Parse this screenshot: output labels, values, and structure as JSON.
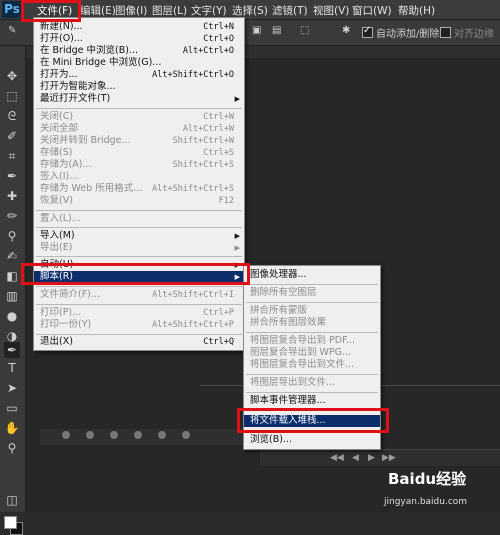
{
  "menubar": {
    "items": [
      "文件(F)",
      "编辑(E)",
      "图像(I)",
      "图层(L)",
      "文字(Y)",
      "选择(S)",
      "滤镜(T)",
      "视图(V)",
      "窗口(W)",
      "帮助(H)"
    ]
  },
  "options": {
    "auto_add_delete": "自动添加/删除",
    "align_edges": "对齐边缘"
  },
  "file_menu": {
    "items": [
      {
        "label": "新建(N)...",
        "shortcut": "Ctrl+N"
      },
      {
        "label": "打开(O)...",
        "shortcut": "Ctrl+O"
      },
      {
        "label": "在 Bridge 中浏览(B)...",
        "shortcut": "Alt+Ctrl+O"
      },
      {
        "label": "在 Mini Bridge 中浏览(G)...",
        "shortcut": ""
      },
      {
        "label": "打开为...",
        "shortcut": "Alt+Shift+Ctrl+O"
      },
      {
        "label": "打开为智能对象...",
        "shortcut": ""
      },
      {
        "label": "最近打开文件(T)",
        "shortcut": ""
      },
      {
        "label": "关闭(C)",
        "shortcut": "Ctrl+W"
      },
      {
        "label": "关闭全部",
        "shortcut": "Alt+Ctrl+W"
      },
      {
        "label": "关闭并转到 Bridge...",
        "shortcut": "Shift+Ctrl+W"
      },
      {
        "label": "存储(S)",
        "shortcut": "Ctrl+S"
      },
      {
        "label": "存储为(A)...",
        "shortcut": "Shift+Ctrl+S"
      },
      {
        "label": "签入(I)...",
        "shortcut": ""
      },
      {
        "label": "存储为 Web 所用格式...",
        "shortcut": "Alt+Shift+Ctrl+S"
      },
      {
        "label": "恢复(V)",
        "shortcut": "F12"
      },
      {
        "label": "置入(L)...",
        "shortcut": ""
      },
      {
        "label": "导入(M)",
        "shortcut": ""
      },
      {
        "label": "导出(E)",
        "shortcut": ""
      },
      {
        "label": "自动(U)",
        "shortcut": ""
      },
      {
        "label": "脚本(R)",
        "shortcut": ""
      },
      {
        "label": "文件简介(F)...",
        "shortcut": "Alt+Shift+Ctrl+I"
      },
      {
        "label": "打印(P)...",
        "shortcut": "Ctrl+P"
      },
      {
        "label": "打印一份(Y)",
        "shortcut": "Alt+Shift+Ctrl+P"
      },
      {
        "label": "退出(X)",
        "shortcut": "Ctrl+Q"
      }
    ]
  },
  "script_menu": {
    "items": [
      {
        "label": "图像处理器..."
      },
      {
        "label": "删除所有空图层"
      },
      {
        "label": "拼合所有蒙版"
      },
      {
        "label": "拼合所有图层效果"
      },
      {
        "label": "将图层复合导出到 PDF..."
      },
      {
        "label": "图层复合导出到 WPG..."
      },
      {
        "label": "将图层复合导出到文件..."
      },
      {
        "label": "将图层导出到文件..."
      },
      {
        "label": "脚本事件管理器..."
      },
      {
        "label": "将文件载入堆栈..."
      },
      {
        "label": "浏览(B)..."
      }
    ]
  },
  "watermark": {
    "brand": "Baidu经验",
    "url": "jingyan.baidu.com"
  },
  "colors": {
    "highlight": "#0b2d6b",
    "red_box": "#e01018"
  }
}
